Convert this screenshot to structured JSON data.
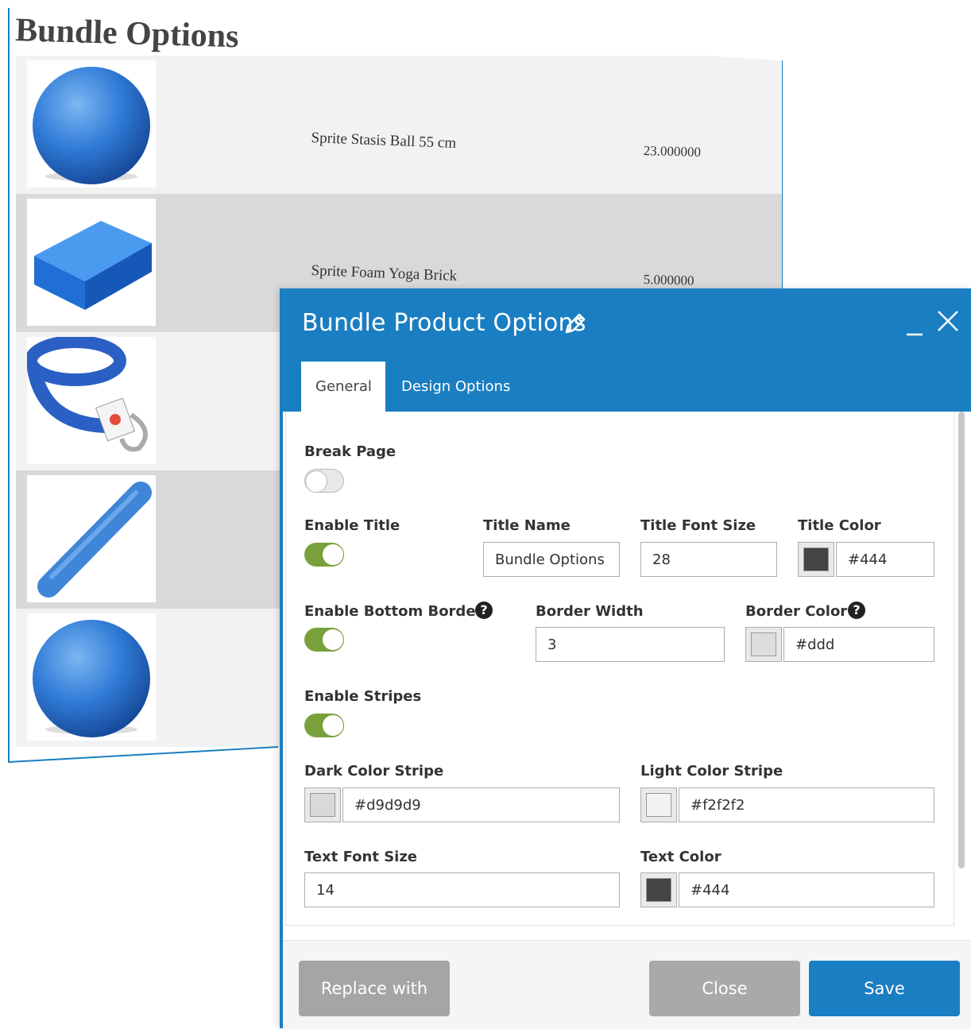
{
  "preview": {
    "title": "Bundle Options",
    "items": [
      {
        "name": "Sprite Stasis Ball 55 cm",
        "price": "23.000000",
        "image": "stasis-ball-image"
      },
      {
        "name": "Sprite Foam Yoga Brick",
        "price": "5.000000",
        "image": "yoga-brick-image"
      },
      {
        "name": "",
        "price": "",
        "image": "yoga-strap-image"
      },
      {
        "name": "",
        "price": "",
        "image": "foam-roller-image"
      },
      {
        "name": "",
        "price": "",
        "image": "stasis-ball-image"
      }
    ]
  },
  "modal": {
    "title": "Bundle Product Options",
    "icons": {
      "edit": "pencil-icon",
      "minimize": "minimize-icon",
      "close": "close-icon",
      "help": "question-circle-icon"
    },
    "tabs": [
      {
        "label": "General",
        "active": true
      },
      {
        "label": "Design Options",
        "active": false
      }
    ],
    "fields": {
      "break_page": {
        "label": "Break Page",
        "enabled": false
      },
      "enable_title": {
        "label": "Enable Title",
        "enabled": true
      },
      "title_name": {
        "label": "Title Name",
        "value": "Bundle Options"
      },
      "title_font_size": {
        "label": "Title Font Size",
        "value": "28"
      },
      "title_color": {
        "label": "Title Color",
        "value": "#444",
        "swatch": "#444444"
      },
      "enable_bottom_border": {
        "label": "Enable Bottom Border",
        "enabled": true,
        "help": "?"
      },
      "border_width": {
        "label": "Border Width",
        "value": "3"
      },
      "border_color": {
        "label": "Border Color",
        "value": "#ddd",
        "swatch": "#dddddd",
        "help": "?"
      },
      "enable_stripes": {
        "label": "Enable Stripes",
        "enabled": true
      },
      "dark_color_stripe": {
        "label": "Dark Color Stripe",
        "value": "#d9d9d9",
        "swatch": "#d9d9d9"
      },
      "light_color_stripe": {
        "label": "Light Color Stripe",
        "value": "#f2f2f2",
        "swatch": "#f2f2f2"
      },
      "text_font_size": {
        "label": "Text Font Size",
        "value": "14"
      },
      "text_color": {
        "label": "Text Color",
        "value": "#444",
        "swatch": "#444444"
      }
    },
    "footer": {
      "replace_label": "Replace with",
      "close_label": "Close",
      "save_label": "Save"
    }
  },
  "colors": {
    "accent": "#1a7ec2",
    "toggle_on": "#79a13b",
    "button_gray": "#a9a9a9"
  }
}
